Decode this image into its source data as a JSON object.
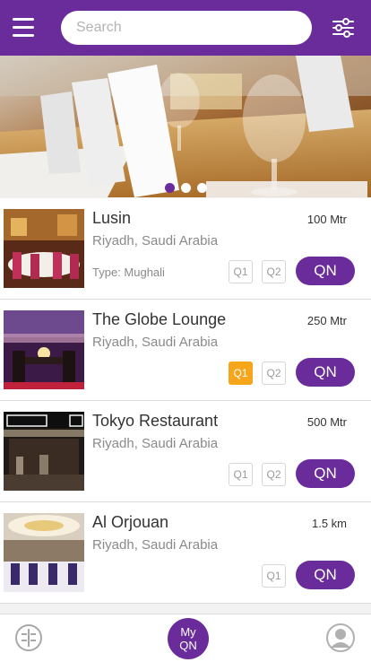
{
  "header": {
    "search_placeholder": "Search",
    "accent": "#6a2c9a"
  },
  "banner": {
    "slide_count": 3,
    "active_slide": 1
  },
  "restaurants": [
    {
      "name": "Lusin",
      "location": "Riyadh, Saudi Arabia",
      "distance": "100 Mtr",
      "type": "Type: Mughali",
      "q1": "Q1",
      "q2": "Q2",
      "q1_active": false,
      "qn": "QN"
    },
    {
      "name": "The Globe Lounge",
      "location": "Riyadh, Saudi Arabia",
      "distance": "250 Mtr",
      "q1": "Q1",
      "q2": "Q2",
      "q1_active": true,
      "qn": "QN"
    },
    {
      "name": "Tokyo Restaurant",
      "location": "Riyadh, Saudi Arabia",
      "distance": "500 Mtr",
      "q1": "Q1",
      "q2": "Q2",
      "q1_active": false,
      "qn": "QN"
    },
    {
      "name": "Al Orjouan",
      "location": "Riyadh, Saudi Arabia",
      "distance": "1.5 km",
      "q1": "Q1",
      "q1_active": false,
      "qn": "QN"
    }
  ],
  "bottom_nav": {
    "center_line1": "My",
    "center_line2": "QN"
  },
  "colors": {
    "primary": "#6a2c9a",
    "q_active": "#f7a51a"
  }
}
